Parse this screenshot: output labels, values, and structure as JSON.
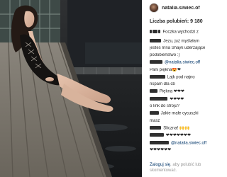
{
  "post": {
    "username": "natalia.siwiec.of",
    "likes_text": "Liczba polubień: 9 180"
  },
  "comments": [
    {
      "lines": [
        {
          "blurs": [
            3,
            8,
            4
          ],
          "text": "Foczka wychodzi z"
        },
        {
          "blurs": [],
          "text": ""
        }
      ]
    },
    {
      "lines": [
        {
          "blurs": [
            18
          ],
          "text": "Jezu, już myślałam"
        },
        {
          "blurs": [],
          "text": "jesteś Irina Shayk uderzające"
        },
        {
          "blurs": [],
          "text": "podobieństwo :)"
        }
      ]
    },
    {
      "lines": [
        {
          "blurs": [
            20
          ],
          "text": "@natalia.siwiec.off"
        },
        {
          "blurs": [],
          "text": "Pani piękna😍❤"
        }
      ]
    },
    {
      "lines": [
        {
          "blurs": [
            24
          ],
          "text": "Lajk pod najno"
        },
        {
          "blurs": [],
          "text": "nspam dla cb"
        }
      ]
    },
    {
      "lines": [
        {
          "blurs": [
            12
          ],
          "text": "Piękna ❤❤❤"
        }
      ]
    },
    {
      "lines": [
        {
          "blurs": [
            28
          ],
          "text": "❤❤❤❤"
        },
        {
          "blurs": [],
          "text": "o link do stroju?"
        }
      ]
    },
    {
      "lines": [
        {
          "blurs": [
            14
          ],
          "text": "Jakie małe cycuszki"
        },
        {
          "blurs": [],
          "text": "masz"
        }
      ]
    },
    {
      "lines": [
        {
          "blurs": [
            18
          ],
          "text": "Śliczna! 🙌🙌"
        }
      ]
    },
    {
      "lines": [
        {
          "blurs": [
            22
          ],
          "text": "❤❤❤❤❤❤❤"
        }
      ]
    },
    {
      "lines": [
        {
          "blurs": [
            30
          ],
          "text": "@natalia.siwiec.off"
        },
        {
          "blurs": [],
          "text": "❤❤❤❤❤❤"
        }
      ]
    }
  ],
  "footer": {
    "login_link": "Zaloguj się",
    "login_rest": ", aby polubić lub skomentować."
  },
  "colors": {
    "link": "#003569",
    "text": "#262626",
    "muted": "#999999"
  }
}
